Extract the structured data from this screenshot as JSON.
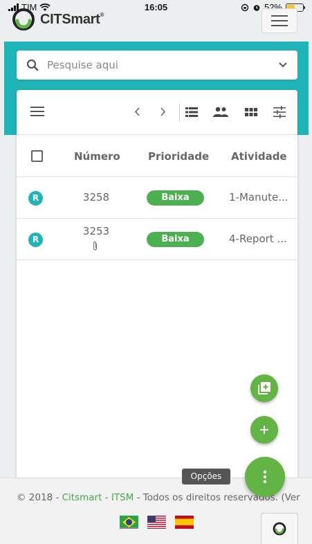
{
  "status_bar": {
    "carrier": "TIM",
    "time": "16:05",
    "battery": "52%",
    "battery_level": 0.52
  },
  "header": {
    "brand_prefix": "CIT",
    "brand_suffix": "Smart",
    "brand_mark": "®",
    "menu_icon": "hamburger-icon"
  },
  "search": {
    "placeholder": "Pesquise aqui",
    "icon": "search-icon",
    "dropdown_icon": "chevron-down-icon"
  },
  "toolbar": {
    "icons": [
      "menu-icon",
      "chevron-left-icon",
      "chevron-right-icon",
      "list-view-icon",
      "people-icon",
      "grid-view-icon",
      "filter-settings-icon"
    ]
  },
  "table": {
    "columns": [
      "Número",
      "Prioridade",
      "Atividade"
    ],
    "rows": [
      {
        "badge": "R",
        "numero": "3258",
        "prioridade": "Baixa",
        "atividade": "1-Manute...",
        "attachment": false
      },
      {
        "badge": "R",
        "numero": "3253",
        "prioridade": "Baixa",
        "atividade": "4-Report ...",
        "attachment": true
      }
    ]
  },
  "fab": {
    "tooltip": "Opções",
    "icons": [
      "add-to-library-icon",
      "plus-icon",
      "more-vert-icon"
    ]
  },
  "footer": {
    "copy_prefix": "© 2018 - ",
    "link1": "Citsmart",
    "sep": " - ",
    "link2": "ITSM",
    "copy_suffix": " - Todos os direitos reservados. (Ver",
    "languages": [
      "pt-BR",
      "en-US",
      "es-ES"
    ]
  },
  "colors": {
    "teal": "#1fb5b8",
    "green": "#62b445",
    "priority_low": "#4caf50"
  }
}
